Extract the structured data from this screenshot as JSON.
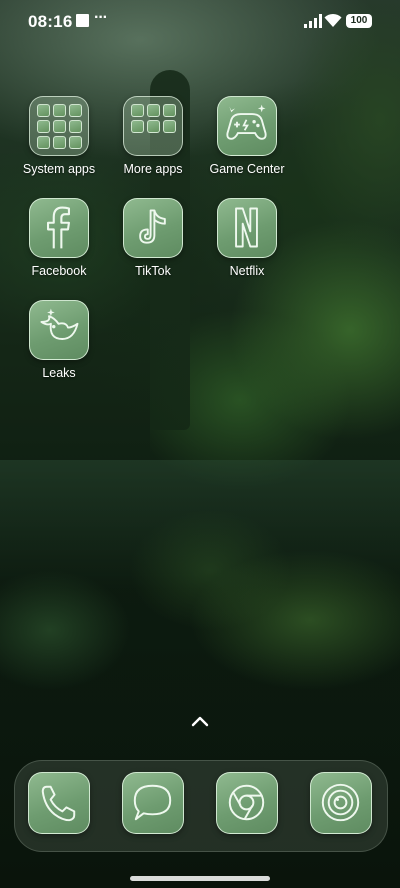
{
  "status_bar": {
    "time": "08:16",
    "battery": "100",
    "overflow_dots": "···"
  },
  "home_apps": [
    {
      "label": "System apps",
      "icon": "folder-icon"
    },
    {
      "label": "More apps",
      "icon": "folder-icon"
    },
    {
      "label": "Game Center",
      "icon": "game-controller-icon"
    },
    {
      "label": "Facebook",
      "icon": "facebook-icon"
    },
    {
      "label": "TikTok",
      "icon": "tiktok-icon"
    },
    {
      "label": "Netflix",
      "icon": "netflix-icon"
    },
    {
      "label": "Leaks",
      "icon": "bird-icon"
    }
  ],
  "dock_apps": [
    {
      "icon": "phone-icon"
    },
    {
      "icon": "messages-icon"
    },
    {
      "icon": "browser-icon"
    },
    {
      "icon": "camera-icon"
    }
  ],
  "colors": {
    "icon_green": "#6e9c70",
    "icon_outline": "#e8f5e8"
  }
}
